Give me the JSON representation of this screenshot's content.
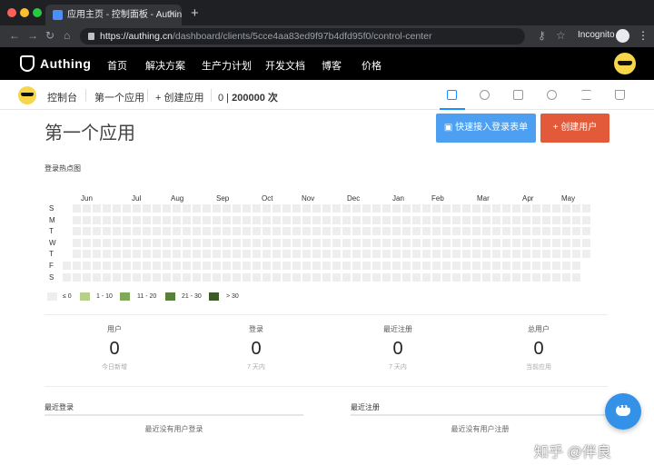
{
  "browser": {
    "tab_title": "应用主页 - 控制面板 - Authing",
    "tab_close": "✕",
    "new_tab": "+",
    "url_host": "https://authing.cn",
    "url_path": "/dashboard/clients/5cce4aa83ed9f97b4dfd95f0/control-center",
    "incognito_label": "Incognito",
    "traffic_colors": [
      "#ff5f57",
      "#febc2e",
      "#28c840"
    ]
  },
  "appnav": {
    "logo_text": "Authing",
    "links": [
      "首页",
      "解决方案",
      "生产力计划",
      "开发文档",
      "博客",
      "价格"
    ]
  },
  "subbar": {
    "console": "控制台",
    "app_name": "第一个应用",
    "create_app": "+ 创建应用",
    "usage_used": "0",
    "usage_sep": " | ",
    "usage_total": "200000 次"
  },
  "main": {
    "title": "第一个应用",
    "btn_quick_login": "快速接入登录表单",
    "btn_create_user": "创建用户",
    "btn_create_user_prefix": "+",
    "heatmap_title": "登录热点图"
  },
  "heatmap": {
    "months": [
      "Jun",
      "Jul",
      "Aug",
      "Sep",
      "Oct",
      "Nov",
      "Dec",
      "Jan",
      "Feb",
      "Mar",
      "Apr",
      "May"
    ],
    "days": [
      "S",
      "M",
      "T",
      "W",
      "T",
      "F",
      "S"
    ],
    "legend": [
      {
        "label": "≤ 0",
        "color": "#eeeeee"
      },
      {
        "label": "1 - 10",
        "color": "#b6cf8b"
      },
      {
        "label": "11 - 20",
        "color": "#7fa85a"
      },
      {
        "label": "21 - 30",
        "color": "#58803a"
      },
      {
        "label": "> 30",
        "color": "#3c5a25"
      }
    ]
  },
  "stats": [
    {
      "label": "用户",
      "value": "0",
      "sub": "今日新增"
    },
    {
      "label": "登录",
      "value": "0",
      "sub": "7 天内"
    },
    {
      "label": "最近注册",
      "value": "0",
      "sub": "7 天内"
    },
    {
      "label": "总用户",
      "value": "0",
      "sub": "当前应用"
    }
  ],
  "sections": {
    "recent_logins_title": "最近登录",
    "recent_logins_empty": "最近没有用户登录",
    "recent_signups_title": "最近注册",
    "recent_signups_empty": "最近没有用户注册"
  },
  "chat_icon_dots": "•••",
  "watermark": "知乎 @伴良"
}
